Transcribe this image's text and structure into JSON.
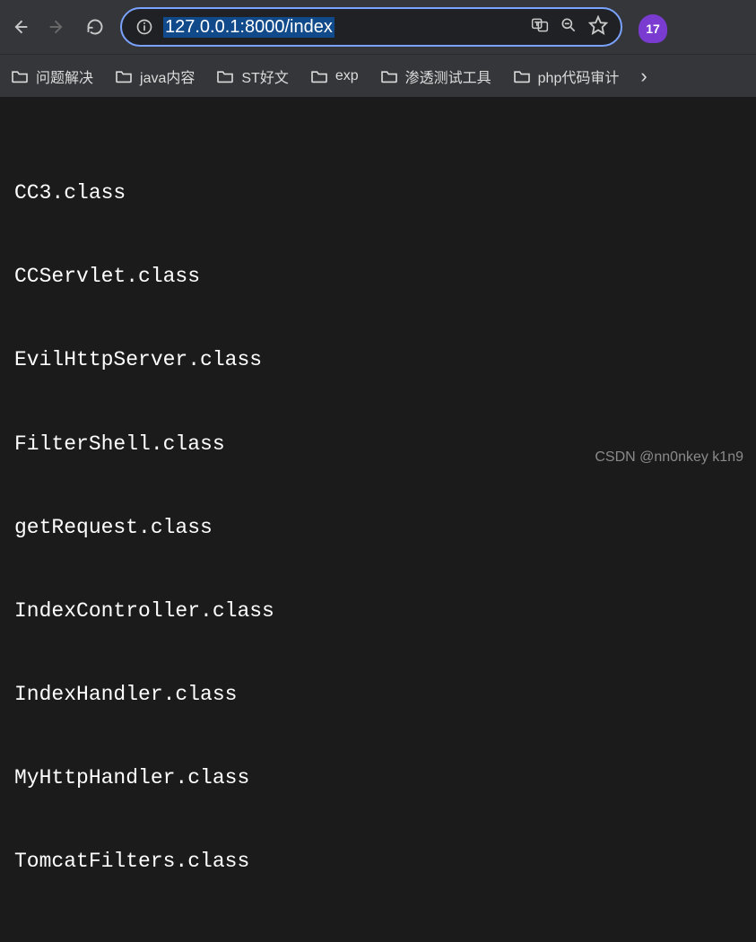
{
  "toolbar": {
    "url": "127.0.0.1:8000/index",
    "extension_badge": "17"
  },
  "bookmarks": [
    {
      "label": "问题解决"
    },
    {
      "label": "java内容"
    },
    {
      "label": "ST好文"
    },
    {
      "label": "exp"
    },
    {
      "label": "渗透测试工具"
    },
    {
      "label": "php代码审计"
    }
  ],
  "files": [
    "CC3.class",
    "CCServlet.class",
    "EvilHttpServer.class",
    "FilterShell.class",
    "getRequest.class",
    "IndexController.class",
    "IndexHandler.class",
    "MyHttpHandler.class",
    "TomcatFilters.class"
  ],
  "watermark": "CSDN @nn0nkey k1n9"
}
